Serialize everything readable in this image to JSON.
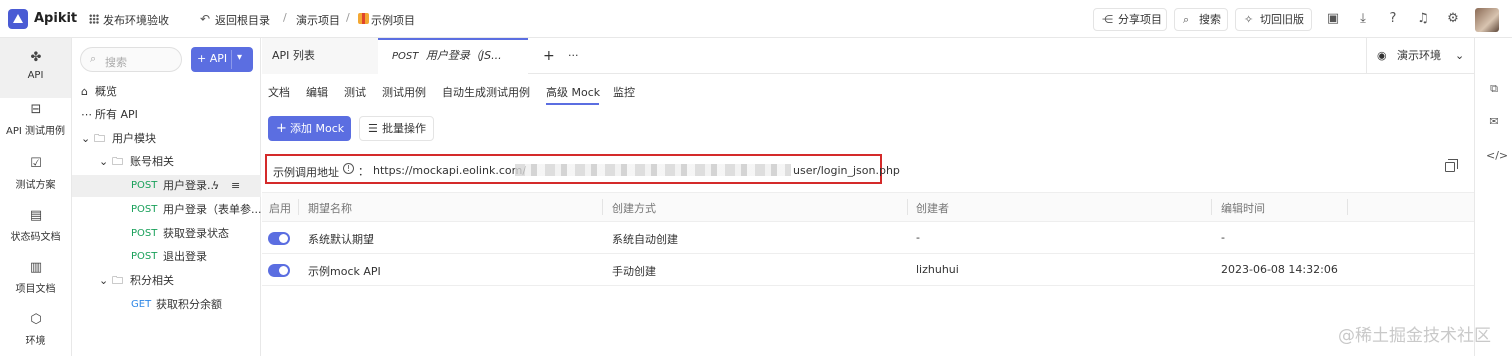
{
  "topbar": {
    "brand": "Apikit",
    "publish_label": "发布环境验收",
    "back_label": "返回根目录",
    "crumb_sep1": "/",
    "crumb1": "演示项目",
    "crumb_sep2": "/",
    "crumb2": "示例项目",
    "share_label": "分享项目",
    "search_label": "搜索",
    "switch_label": "切回旧版"
  },
  "leftnav": {
    "items": [
      {
        "label": "API",
        "icon": "api-icon"
      },
      {
        "label": "API 测试用例",
        "icon": "test-case-icon"
      },
      {
        "label": "测试方案",
        "icon": "test-plan-icon"
      },
      {
        "label": "状态码文档",
        "icon": "status-doc-icon"
      },
      {
        "label": "项目文档",
        "icon": "project-doc-icon"
      },
      {
        "label": "环境",
        "icon": "env-icon"
      }
    ]
  },
  "tree": {
    "search_placeholder": "搜索",
    "add_api_label": "+ API",
    "overview": "概览",
    "all_api": "所有 API",
    "module_user": "用户模块",
    "folder_account": "账号相关",
    "api1_method": "POST",
    "api1_name": "用户登录...",
    "api2_method": "POST",
    "api2_name": "用户登录（表单参...",
    "api3_method": "POST",
    "api3_name": "获取登录状态",
    "api4_method": "POST",
    "api4_name": "退出登录",
    "folder_points": "积分相关",
    "api5_method": "GET",
    "api5_name": "获取积分余额"
  },
  "tabs": {
    "api_list": "API 列表",
    "active_method": "POST",
    "active_name": "用户登录（JS...",
    "add": "+",
    "more": "···",
    "env": "演示环境"
  },
  "subtabs": [
    "文档",
    "编辑",
    "测试",
    "测试用例",
    "自动生成测试用例",
    "高级 Mock",
    "监控"
  ],
  "actions": {
    "add_mock": "添加 Mock",
    "batch": "批量操作"
  },
  "mock_url": {
    "label": "示例调用地址",
    "colon": "：",
    "url_prefix": "https://mockapi.eolink.com/",
    "url_suffix": "user/login_json.php"
  },
  "table": {
    "headers": [
      "启用",
      "期望名称",
      "创建方式",
      "创建者",
      "编辑时间"
    ],
    "rows": [
      {
        "enabled": true,
        "name": "系统默认期望",
        "method": "系统自动创建",
        "creator": "-",
        "time": "-"
      },
      {
        "enabled": true,
        "name": "示例mock API",
        "method": "手动创建",
        "creator": "lizhuhui",
        "time": "2023-06-08 14:32:06"
      }
    ]
  },
  "watermark": "@稀土掘金技术社区",
  "colors": {
    "accent": "#5b6ee1",
    "post": "#19a05a",
    "get": "#2f87e6",
    "highlight": "#d42a2a"
  }
}
